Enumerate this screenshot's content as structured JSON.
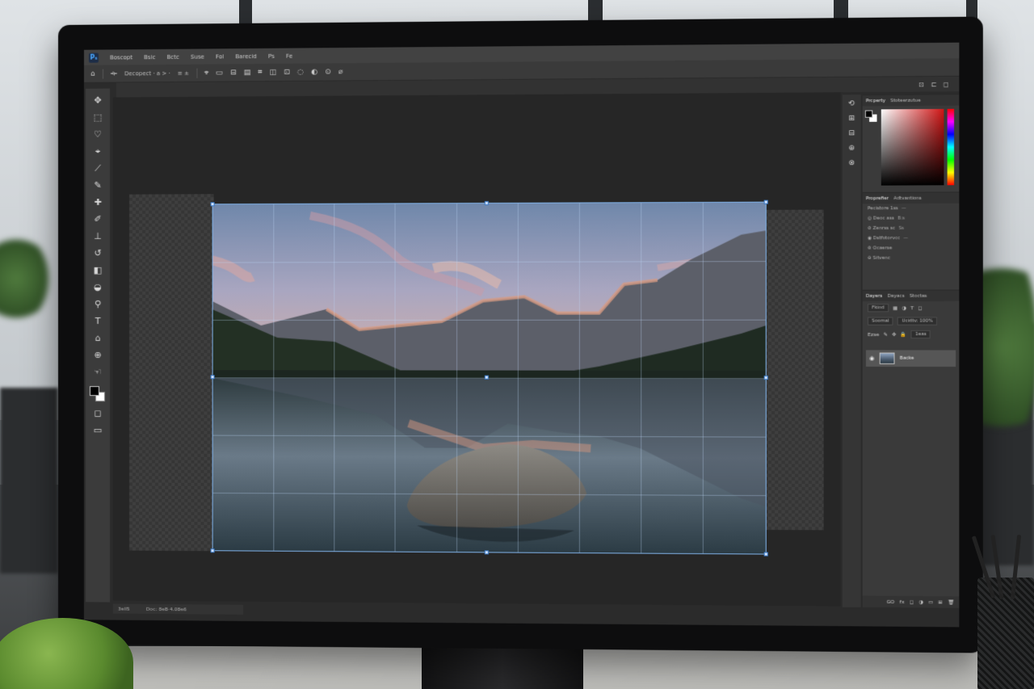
{
  "app": {
    "menu": [
      "Pₛ",
      "Boscopt",
      "Bsic",
      "Bctc",
      "Suse",
      "Fol",
      "Barecid",
      "Ps",
      "Fe"
    ],
    "options": {
      "home_icon": "home-icon",
      "preset_label": "Decopect  ·  a  >  ·",
      "ratio_label": "≡  ±",
      "toggles": [
        "⌖",
        "▭",
        "⊟",
        "▤",
        "⌗",
        "◫",
        "⊡",
        "◌",
        "◐",
        "⊙",
        "⌀"
      ]
    },
    "tabstrip_icons": [
      "⊡",
      "⊏",
      "◻"
    ]
  },
  "toolbar": {
    "tools": [
      {
        "name": "move-tool",
        "glyph": "✥"
      },
      {
        "name": "marquee-tool",
        "glyph": "⬚"
      },
      {
        "name": "lasso-tool",
        "glyph": "♡"
      },
      {
        "name": "quick-select-tool",
        "glyph": "⌖"
      },
      {
        "name": "crop-tool",
        "glyph": "⟋"
      },
      {
        "name": "eyedropper-tool",
        "glyph": "✎"
      },
      {
        "name": "healing-tool",
        "glyph": "✚"
      },
      {
        "name": "brush-tool",
        "glyph": "✐"
      },
      {
        "name": "clone-stamp-tool",
        "glyph": "⊥"
      },
      {
        "name": "history-brush-tool",
        "glyph": "↺"
      },
      {
        "name": "eraser-tool",
        "glyph": "◧"
      },
      {
        "name": "gradient-tool",
        "glyph": "◒"
      },
      {
        "name": "dodge-tool",
        "glyph": "⚲"
      },
      {
        "name": "text-tool",
        "glyph": "T"
      },
      {
        "name": "path-select-tool",
        "glyph": "⌂"
      },
      {
        "name": "zoom-tool",
        "glyph": "⊕"
      },
      {
        "name": "hand-tool",
        "glyph": "☜"
      }
    ],
    "extra": [
      "◻",
      "▭"
    ]
  },
  "statusbar": {
    "zoom": "3ell5",
    "info": "Doc: 8eB·4.08e6"
  },
  "mini_column": [
    "⟲",
    "⊞",
    "⊟",
    "⊕",
    "⊗"
  ],
  "panels": {
    "color": {
      "tabs": [
        "Prcperty",
        "Stoteerzutue"
      ],
      "fg": "#000000",
      "bg": "#ffffff"
    },
    "properties": {
      "tabs": [
        "Proprefier",
        "Adtvantions"
      ],
      "rows": [
        {
          "label": "Pecistore 1ss",
          "value": "—"
        },
        {
          "label": "◎  Deoc ass",
          "value": "B:s"
        },
        {
          "label": "⊘  Zenrss sc",
          "value": "Ss"
        },
        {
          "label": "◉  Dstfotorvcc",
          "value": "—"
        },
        {
          "label": "⊚  Ocaerse",
          "value": ""
        },
        {
          "label": "⊖  Sitvenc",
          "value": ""
        }
      ]
    },
    "layers": {
      "tabs": [
        "Dayers",
        "Dayacs",
        "Stoctas"
      ],
      "kind": "Fkind",
      "blend": "Soomal",
      "opacity": "Ucidtv: 100%",
      "lock": "Ezse",
      "fill": "1eas",
      "layer_name": "Backe",
      "footer": [
        "GO",
        "fx",
        "◻",
        "◑",
        "▭",
        "⊞",
        "🗑"
      ]
    }
  }
}
